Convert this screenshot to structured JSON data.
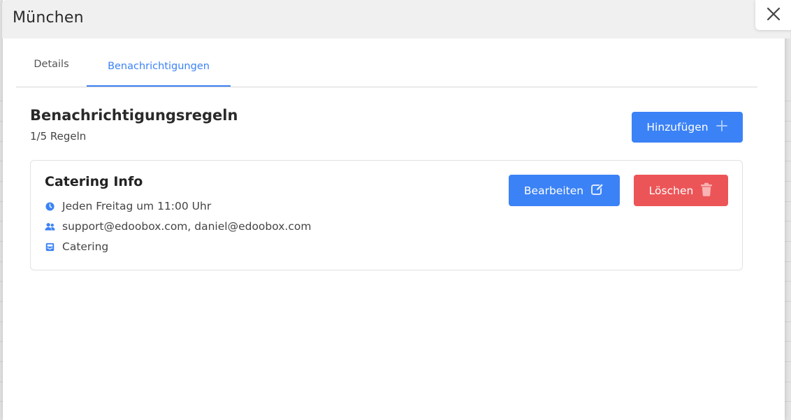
{
  "modal": {
    "title": "München",
    "close_icon": "close-icon"
  },
  "tabs": [
    {
      "label": "Details",
      "active": false
    },
    {
      "label": "Benachrichtigungen",
      "active": true
    }
  ],
  "section": {
    "title": "Benachrichtigungsregeln",
    "subtitle": "1/5 Regeln",
    "add_button": {
      "label": "Hinzufügen",
      "icon": "plus-icon"
    }
  },
  "rules": [
    {
      "title": "Catering Info",
      "schedule": "Jeden Freitag um 11:00 Uhr",
      "recipients": "support@edoobox.com, daniel@edoobox.com",
      "category": "Catering",
      "edit_button": {
        "label": "Bearbeiten",
        "icon": "edit-icon"
      },
      "delete_button": {
        "label": "Löschen",
        "icon": "trash-icon"
      }
    }
  ],
  "colors": {
    "primary": "#3b82f6",
    "danger": "#ec5558",
    "header_bg": "#f0f0f0"
  }
}
